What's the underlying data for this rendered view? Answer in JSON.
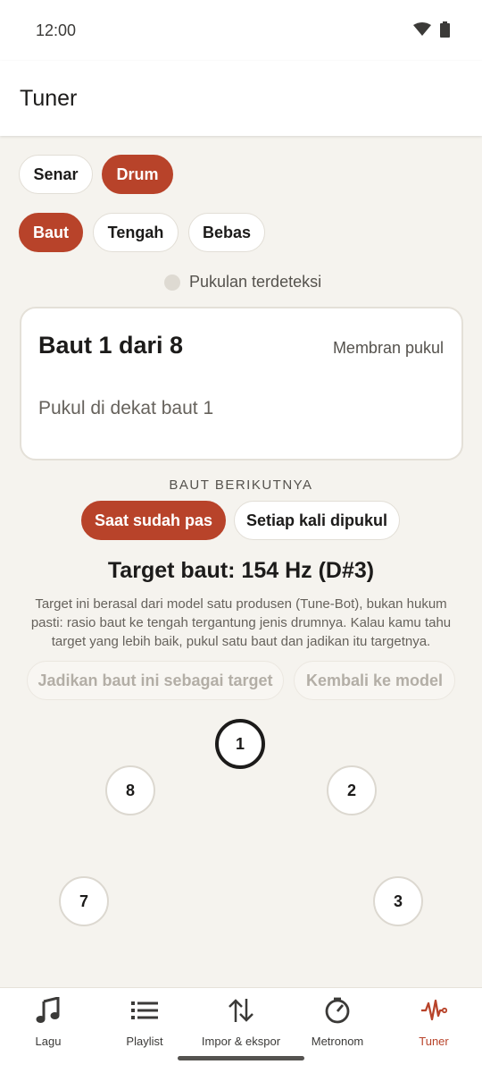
{
  "status": {
    "time": "12:00"
  },
  "app": {
    "title": "Tuner"
  },
  "instrument_tabs": [
    {
      "label": "Senar",
      "active": false
    },
    {
      "label": "Drum",
      "active": true
    }
  ],
  "mode_tabs": [
    {
      "label": "Baut",
      "active": true
    },
    {
      "label": "Tengah",
      "active": false
    },
    {
      "label": "Bebas",
      "active": false
    }
  ],
  "detection": {
    "label": "Pukulan terdeteksi"
  },
  "card": {
    "title": "Baut 1 dari 8",
    "side": "Membran pukul",
    "hint": "Pukul di dekat baut 1"
  },
  "next_bolt": {
    "label": "BAUT BERIKUTNYA",
    "options": [
      {
        "label": "Saat sudah pas",
        "active": true
      },
      {
        "label": "Setiap kali dipukul",
        "active": false
      }
    ]
  },
  "target": {
    "title": "Target baut: 154 Hz (D#3)",
    "note": "Target ini berasal dari model satu produsen (Tune-Bot), bukan hukum pasti: rasio baut ke tengah tergantung jenis drumnya. Kalau kamu tahu target yang lebih baik, pukul satu baut dan jadikan itu targetnya.",
    "set_target_label": "Jadikan baut ini sebagai target",
    "reset_label": "Kembali ke model"
  },
  "bolts": {
    "current": "1",
    "labels": [
      "1",
      "2",
      "3",
      "7",
      "8"
    ]
  },
  "nav": [
    {
      "label": "Lagu",
      "icon": "music-note-icon",
      "active": false
    },
    {
      "label": "Playlist",
      "icon": "list-icon",
      "active": false
    },
    {
      "label": "Impor & ekspor",
      "icon": "swap-vertical-icon",
      "active": false
    },
    {
      "label": "Metronom",
      "icon": "metronome-icon",
      "active": false
    },
    {
      "label": "Tuner",
      "icon": "waveform-icon",
      "active": true
    }
  ],
  "colors": {
    "accent": "#b8432a",
    "background": "#f5f3ee",
    "surface": "#ffffff"
  }
}
